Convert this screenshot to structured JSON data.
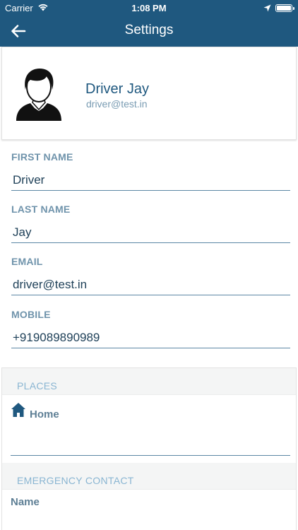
{
  "status_bar": {
    "carrier": "Carrier",
    "time": "1:08 PM"
  },
  "nav": {
    "title": "Settings"
  },
  "profile": {
    "name": "Driver Jay",
    "email": "driver@test.in"
  },
  "form": {
    "first_name": {
      "label": "FIRST NAME",
      "value": "Driver"
    },
    "last_name": {
      "label": "LAST NAME",
      "value": "Jay"
    },
    "email": {
      "label": "EMAIL",
      "value": "driver@test.in"
    },
    "mobile": {
      "label": "MOBILE",
      "value": "+919089890989"
    }
  },
  "places": {
    "header": "PLACES",
    "home_label": "Home"
  },
  "emergency": {
    "header": "EMERGENCY CONTACT",
    "name_label": "Name"
  },
  "colors": {
    "header_bg": "#1f587f",
    "label": "#6f93ab",
    "section_header": "#89b5d2",
    "input_line": "#5b87a4"
  },
  "icons": [
    "wifi-icon",
    "location-arrow-icon",
    "battery-icon",
    "back-arrow-icon",
    "avatar-icon",
    "home-icon"
  ]
}
